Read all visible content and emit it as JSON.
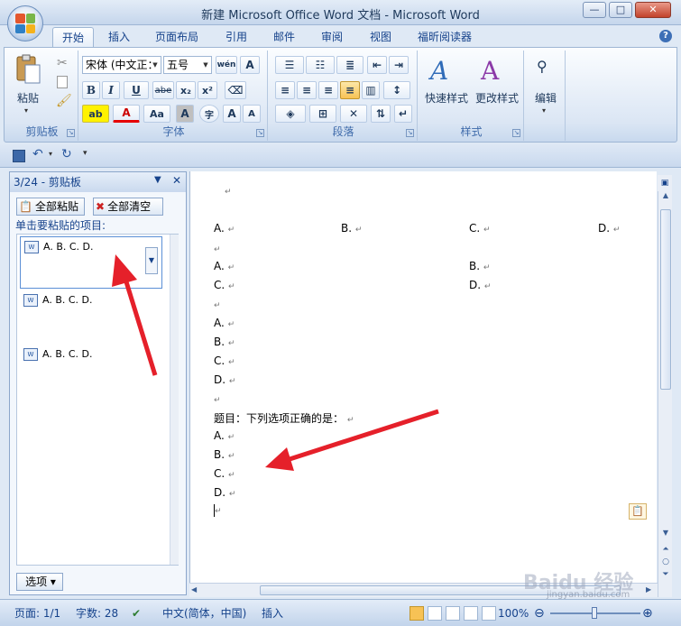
{
  "window": {
    "title": "新建 Microsoft Office Word 文档 - Microsoft Word",
    "min": "—",
    "max": "□",
    "close": "✕"
  },
  "tabs": [
    "开始",
    "插入",
    "页面布局",
    "引用",
    "邮件",
    "审阅",
    "视图",
    "福昕阅读器"
  ],
  "help": "?",
  "ribbon": {
    "clipboard": {
      "label": "剪贴板",
      "paste": "粘贴"
    },
    "font": {
      "label": "字体",
      "font_name": "宋体 (中文正：",
      "font_size": "五号",
      "wen": "wén",
      "a_box": "A",
      "bold": "B",
      "italic": "I",
      "underline": "U",
      "strike": "abe",
      "sub": "x₂",
      "sup": "x²",
      "aa": "Aa",
      "a_shade": "A",
      "a_circle": "字",
      "grow": "A",
      "shrink": "A",
      "highlight": "ab",
      "font_color": "A"
    },
    "paragraph": {
      "label": "段落"
    },
    "styles": {
      "label": "样式",
      "quick": "快速样式",
      "change": "更改样式"
    },
    "editing": {
      "label": "编辑"
    }
  },
  "pane": {
    "title": "3/24 - 剪贴板",
    "paste_all": "全部粘贴",
    "clear_all": "全部清空",
    "instruction": "单击要粘贴的项目:",
    "items": [
      "A. B. C. D.",
      "A. B. C. D.",
      "A. B. C. D."
    ],
    "options": "选项 ▾"
  },
  "document": {
    "row1": [
      "A.",
      "B.",
      "C.",
      "D."
    ],
    "row2a": [
      "A.",
      "B."
    ],
    "row2b": [
      "C.",
      "D."
    ],
    "list1": [
      "A.",
      "B.",
      "C.",
      "D."
    ],
    "question": "题目：下列选项正确的是：",
    "list2": [
      "A.",
      "B.",
      "C.",
      "D."
    ],
    "pilcrow": "↵"
  },
  "status": {
    "page": "页面: 1/1",
    "words": "字数: 28",
    "lang": "中文(简体，中国)",
    "insert": "插入",
    "zoom": "100%"
  },
  "watermark": {
    "text": "Baidu 经验",
    "url": "jingyan.baidu.com"
  }
}
